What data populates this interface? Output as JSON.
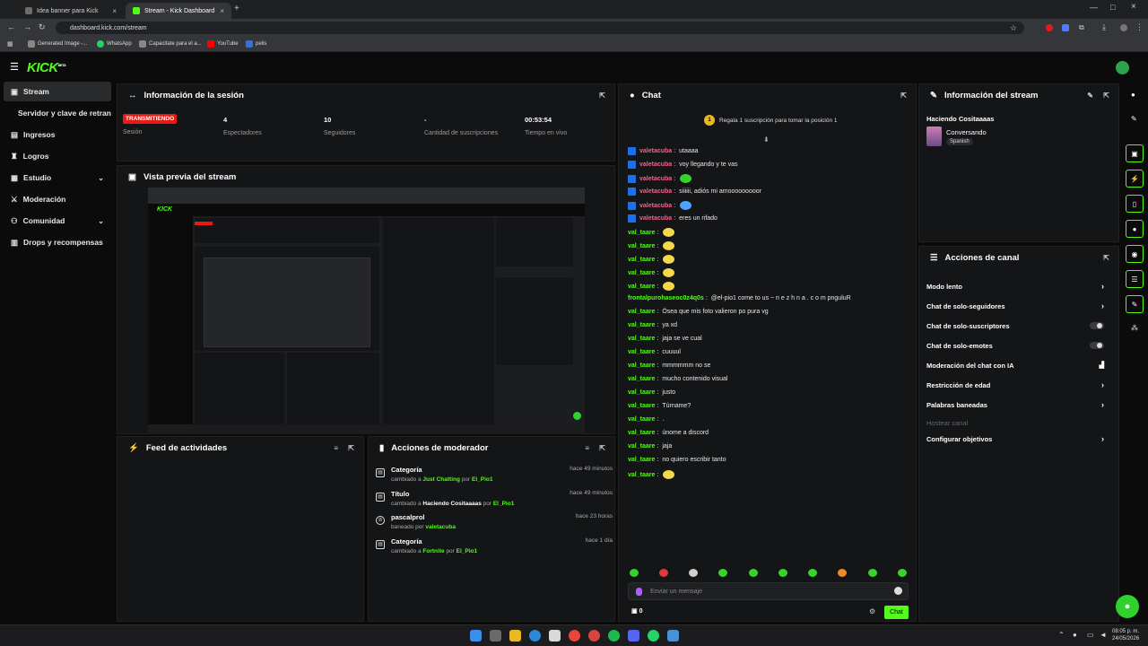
{
  "browser": {
    "tabs": [
      {
        "label": "Idea banner para Kick",
        "fav": "#6b6b6b"
      },
      {
        "label": "Stream - Kick Dashboard",
        "fav": "#53fc18"
      }
    ],
    "url": "dashboard.kick.com/stream",
    "bookmarks": [
      "Generated Image -...",
      "WhatsApp",
      "Capacitate para el a...",
      "YouTube",
      "pelis"
    ]
  },
  "app": {
    "logo": "KICK",
    "logo_sup": "BETA"
  },
  "sidebar": {
    "items": [
      {
        "label": "Stream"
      },
      {
        "label": "Servidor y clave de retransmisión"
      },
      {
        "label": "Ingresos"
      },
      {
        "label": "Logros"
      },
      {
        "label": "Estudio"
      },
      {
        "label": "Moderación"
      },
      {
        "label": "Comunidad"
      },
      {
        "label": "Drops y recompensas"
      }
    ]
  },
  "session": {
    "title": "Información de la sesión",
    "status": "TRANSMITIENDO",
    "status_label": "Sesión",
    "stats": [
      {
        "value": "4",
        "label": "Espectadores"
      },
      {
        "value": "10",
        "label": "Seguidores"
      },
      {
        "value": "-",
        "label": "Cantidad de suscripciones"
      },
      {
        "value": "00:53:54",
        "label": "Tiempo en vivo"
      }
    ]
  },
  "preview": {
    "title": "Vista previa del stream"
  },
  "activity": {
    "title": "Feed de actividades"
  },
  "modactions": {
    "title": "Acciones de moderador",
    "items": [
      {
        "title": "Categoría",
        "pre": "cambiado a",
        "value": "Just Chatting",
        "by": "por",
        "user": "El_Pio1",
        "time": "hace 49 minutos"
      },
      {
        "title": "Título",
        "pre": "cambiado a",
        "value": "Haciendo Cositaaaas",
        "by": "por",
        "user": "El_Pio1",
        "time": "hace 49 minutos"
      },
      {
        "title": "pascalprol",
        "pre": "baneado por",
        "value": "",
        "by": "",
        "user": "valetacuba",
        "time": "hace 23 horas"
      },
      {
        "title": "Categoría",
        "pre": "cambiado a",
        "value": "Fortnite",
        "by": "por",
        "user": "El_Pio1",
        "time": "hace 1 día"
      }
    ]
  },
  "chat": {
    "title": "Chat",
    "pinned": "Regala 1 suscripción para tomar la posición 1",
    "pinned_rank": "1",
    "messages": [
      {
        "user": "valetacuba",
        "text": "utaaaa",
        "color": "#ff5c8a",
        "badge": true,
        "emote": ""
      },
      {
        "user": "valetacuba",
        "text": "voy llegando y te vas",
        "color": "#ff5c8a",
        "badge": true,
        "emote": ""
      },
      {
        "user": "valetacuba",
        "text": "",
        "color": "#ff5c8a",
        "badge": true,
        "emote": "#39d12b"
      },
      {
        "user": "valetacuba",
        "text": "siiiiii, adiós mi amooooooooor",
        "color": "#ff5c8a",
        "badge": true,
        "emote": ""
      },
      {
        "user": "valetacuba",
        "text": "",
        "color": "#ff5c8a",
        "badge": true,
        "emote": "#4fa3ff"
      },
      {
        "user": "valetacuba",
        "text": "eres un rifado",
        "color": "#ff5c8a",
        "badge": true,
        "emote": ""
      },
      {
        "user": "val_taare",
        "text": "",
        "color": "#53fc18",
        "badge": false,
        "emote": "#f2d84a"
      },
      {
        "user": "val_taare",
        "text": "",
        "color": "#53fc18",
        "badge": false,
        "emote": "#f2d84a"
      },
      {
        "user": "val_taare",
        "text": "",
        "color": "#53fc18",
        "badge": false,
        "emote": "#f2d84a"
      },
      {
        "user": "val_taare",
        "text": "",
        "color": "#53fc18",
        "badge": false,
        "emote": "#f2d84a"
      },
      {
        "user": "val_taare",
        "text": "",
        "color": "#53fc18",
        "badge": false,
        "emote": "#f2d84a"
      },
      {
        "user": "frontalpurohaseoc0z4q0s",
        "text": "@el-pio1 come to us ~ n e z h n a . c o m pnguluR",
        "color": "#53fc18",
        "badge": false,
        "emote": ""
      },
      {
        "user": "val_taare",
        "text": "Ósea que mis foto valieron po pura vg",
        "color": "#53fc18",
        "badge": false,
        "emote": ""
      },
      {
        "user": "val_taare",
        "text": "ya xd",
        "color": "#53fc18",
        "badge": false,
        "emote": ""
      },
      {
        "user": "val_taare",
        "text": "jaja se ve cual",
        "color": "#53fc18",
        "badge": false,
        "emote": ""
      },
      {
        "user": "val_taare",
        "text": "cuuuul",
        "color": "#53fc18",
        "badge": false,
        "emote": ""
      },
      {
        "user": "val_taare",
        "text": "mmmmmm no se",
        "color": "#53fc18",
        "badge": false,
        "emote": ""
      },
      {
        "user": "val_taare",
        "text": "mucho contenido visual",
        "color": "#53fc18",
        "badge": false,
        "emote": ""
      },
      {
        "user": "val_taare",
        "text": "justo",
        "color": "#53fc18",
        "badge": false,
        "emote": ""
      },
      {
        "user": "val_taare",
        "text": "Túrname?",
        "color": "#53fc18",
        "badge": false,
        "emote": ""
      },
      {
        "user": "val_taare",
        "text": ".",
        "color": "#53fc18",
        "badge": false,
        "emote": ""
      },
      {
        "user": "val_taare",
        "text": "únome a discord",
        "color": "#53fc18",
        "badge": false,
        "emote": ""
      },
      {
        "user": "val_taare",
        "text": "jaja",
        "color": "#53fc18",
        "badge": false,
        "emote": ""
      },
      {
        "user": "val_taare",
        "text": "no quiero escribir tanto",
        "color": "#53fc18",
        "badge": false,
        "emote": ""
      },
      {
        "user": "val_taare",
        "text": "",
        "color": "#53fc18",
        "badge": false,
        "emote": "#f2d84a"
      }
    ],
    "input_placeholder": "Enviar un mensaje",
    "send_label": "Chat",
    "viewer_count": "0",
    "emote_colors": [
      "#39d12b",
      "#e03b3b",
      "#cfcfcf",
      "#39d12b",
      "#39d12b",
      "#39d12b",
      "#39d12b",
      "#f28a2b",
      "#39d12b",
      "#39d12b"
    ]
  },
  "streaminfo": {
    "title": "Información del stream",
    "stream_title": "Haciendo Cositaaaas",
    "category": "Conversando",
    "language": "Spanish"
  },
  "channel": {
    "title": "Acciones de canal",
    "items": [
      {
        "label": "Modo lento",
        "control": "chevron"
      },
      {
        "label": "Chat de solo-seguidores",
        "control": "chevron"
      },
      {
        "label": "Chat de solo-suscriptores",
        "control": "toggle"
      },
      {
        "label": "Chat de solo-emotes",
        "control": "toggle"
      },
      {
        "label": "Moderación del chat con IA",
        "control": "chart"
      },
      {
        "label": "Restricción de edad",
        "control": "chevron"
      },
      {
        "label": "Palabras baneadas",
        "control": "chevron"
      },
      {
        "label": "Hostear canal",
        "control": "disabled"
      },
      {
        "label": "Configurar objetivos",
        "control": "chevron"
      }
    ]
  },
  "taskbar": {
    "time": "08:05 p. m.",
    "date": "24/05/2026"
  }
}
